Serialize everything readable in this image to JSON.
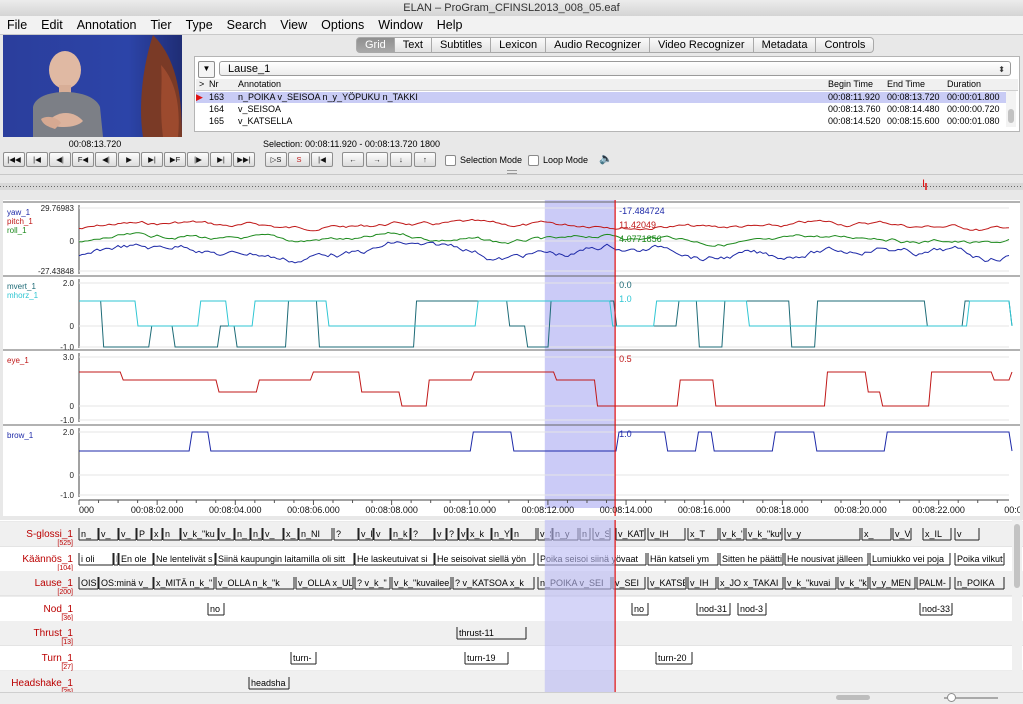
{
  "window": {
    "title": "ELAN – ProGram_CFINSL2013_008_05.eaf"
  },
  "menu": [
    "File",
    "Edit",
    "Annotation",
    "Tier",
    "Type",
    "Search",
    "View",
    "Options",
    "Window",
    "Help"
  ],
  "video": {
    "time": "00:08:13.720"
  },
  "tabs": [
    "Grid",
    "Text",
    "Subtitles",
    "Lexicon",
    "Audio Recognizer",
    "Video Recognizer",
    "Metadata",
    "Controls"
  ],
  "active_tab": "Grid",
  "grid": {
    "tier": "Lause_1",
    "columns": [
      ">",
      "Nr",
      "Annotation",
      "Begin Time",
      "End Time",
      "Duration"
    ],
    "rows": [
      {
        "nr": "163",
        "annotation": "n_POIKA v_SEISOA n_y_YÖPUKU n_TAKKI",
        "begin": "00:08:11.920",
        "end": "00:08:13.720",
        "duration": "00:00:01.800",
        "selected": true
      },
      {
        "nr": "164",
        "annotation": "v_SEISOA",
        "begin": "00:08:13.760",
        "end": "00:08:14.480",
        "duration": "00:00:00.720",
        "selected": false
      },
      {
        "nr": "165",
        "annotation": "v_KATSELLA",
        "begin": "00:08:14.520",
        "end": "00:08:15.600",
        "duration": "00:00:01.080",
        "selected": false
      }
    ]
  },
  "transport": {
    "buttons": [
      "|◀◀",
      "|◀",
      "◀|",
      "F◀",
      "◀|",
      "▶",
      "▶|",
      "▶F",
      "|▶",
      "▶|",
      "▶▶|"
    ],
    "selection_buttons": [
      "▷S",
      "S",
      "|◀"
    ],
    "nav_buttons": [
      "←",
      "→",
      "↓",
      "↑"
    ],
    "selection_label": "Selection: 00:08:11.920 - 00:08:13.720  1800",
    "selection_mode": "Selection Mode",
    "loop_mode": "Loop Mode"
  },
  "time_axis": {
    "labels": [
      "000",
      "00:08:02.000",
      "00:08:04.000",
      "00:08:06.000",
      "00:08:08.000",
      "00:08:10.000",
      "00:08:12.000",
      "00:08:14.000",
      "00:08:16.000",
      "00:08:18.000",
      "00:08:20.000",
      "00:08:22.000",
      "00:08:"
    ],
    "start_s": 480.0,
    "end_s": 503.8,
    "selection": [
      491.92,
      493.72
    ],
    "cursor": 493.72
  },
  "panels": [
    {
      "labels": [
        "yaw_1",
        "pitch_1",
        "roll_1"
      ],
      "label_colors": [
        "#1e2aa8",
        "#c01818",
        "#1d8a1d"
      ],
      "ymax": "29.76983",
      "ymid": "0",
      "ymin": "-27.43848",
      "values": [
        "-17.484724",
        "11.42049",
        "4.0771856"
      ],
      "value_colors": [
        "#1e2aa8",
        "#c01818",
        "#1d8a1d"
      ]
    },
    {
      "labels": [
        "mvert_1",
        "mhorz_1"
      ],
      "label_colors": [
        "#1e6b77",
        "#2fc6d3"
      ],
      "ymax": "2.0",
      "ymid": "0",
      "ymin": "-1.0",
      "values": [
        "0.0",
        "1.0"
      ],
      "value_colors": [
        "#1e6b77",
        "#2fc6d3"
      ]
    },
    {
      "labels": [
        "eye_1"
      ],
      "label_colors": [
        "#c01818"
      ],
      "ymax": "3.0",
      "ymid": "0",
      "ymin": "-1.0",
      "values": [
        "0.5"
      ],
      "value_colors": [
        "#c01818"
      ]
    },
    {
      "labels": [
        "brow_1"
      ],
      "label_colors": [
        "#1e2aa8"
      ],
      "ymax": "2.0",
      "ymid": "0",
      "ymin": "-1.0",
      "values": [
        "1.0"
      ],
      "value_colors": [
        "#1e2aa8"
      ]
    }
  ],
  "tiers": [
    {
      "name": "S-glossi_1",
      "count": "[525]",
      "annotations": [
        "n_",
        "v_",
        "v_",
        "P",
        "x",
        "n",
        "v_k_\"ku",
        "v_",
        "n_",
        "n_",
        "v_",
        "x_",
        "n_NI",
        "?",
        "v_k_\"",
        "v",
        "n_k",
        "?",
        "v",
        "?",
        "v",
        "x_k",
        "n_Y",
        "n",
        "v_S",
        "n_y",
        "n",
        "v_SEI",
        "v_KATS",
        "v_IH",
        "x_T",
        "v_k_\"ott",
        "v_k_\"kuvailee_kuin",
        "v_y",
        "x_",
        "v_VI",
        "x_IL",
        "v"
      ]
    },
    {
      "name": "Käännös_1",
      "count": "[104]",
      "annotations": [
        "i oli",
        "En",
        "En ole",
        "Ne lentelivät s",
        "Siinä kaupungin laitamilla oli sitt",
        "He laskeutuivat si",
        "He seisoivat siellä yön",
        "Poika seisoi siinä yövaat",
        "Hän katseli ym",
        "Sitten he päätti",
        "He nousivat jälleen",
        "Lumiukko vei poja",
        "Poika vilkutt"
      ]
    },
    {
      "name": "Lause_1",
      "count": "[200]",
      "annotations": [
        "OIS",
        "OS:minä v_",
        "x_MITÄ n_k_\"",
        "v_OLLA n_k_\"k",
        "v_OLLA x_UL",
        "? v_k_\"",
        "v_k_\"kuvailee_",
        "? v_KATSOA x_k",
        "n_POIKA v_SEI",
        "v_SEI",
        "v_KATSE",
        "v_IH",
        "x_JO x_TAKAI",
        "v_k_\"kuvai",
        "v_k_\"k",
        "v_y_MEN",
        "PALM-",
        "n_POIKA"
      ]
    },
    {
      "name": "Nod_1",
      "count": "[36]",
      "annotations": [
        "no",
        "no",
        "nod-31",
        "nod-3",
        "nod-33"
      ]
    },
    {
      "name": "Thrust_1",
      "count": "[13]",
      "annotations": [
        "thrust-11"
      ]
    },
    {
      "name": "Turn_1",
      "count": "[27]",
      "annotations": [
        "turn-",
        "turn-19",
        "turn-20"
      ]
    },
    {
      "name": "Headshake_1",
      "count": "[25]",
      "annotations": [
        "headsha"
      ]
    }
  ],
  "colors": {
    "selection": "#b9b9f4",
    "cursor": "#e01010",
    "tier_name": "#b00000",
    "selected_row": "#c9ccf5"
  }
}
